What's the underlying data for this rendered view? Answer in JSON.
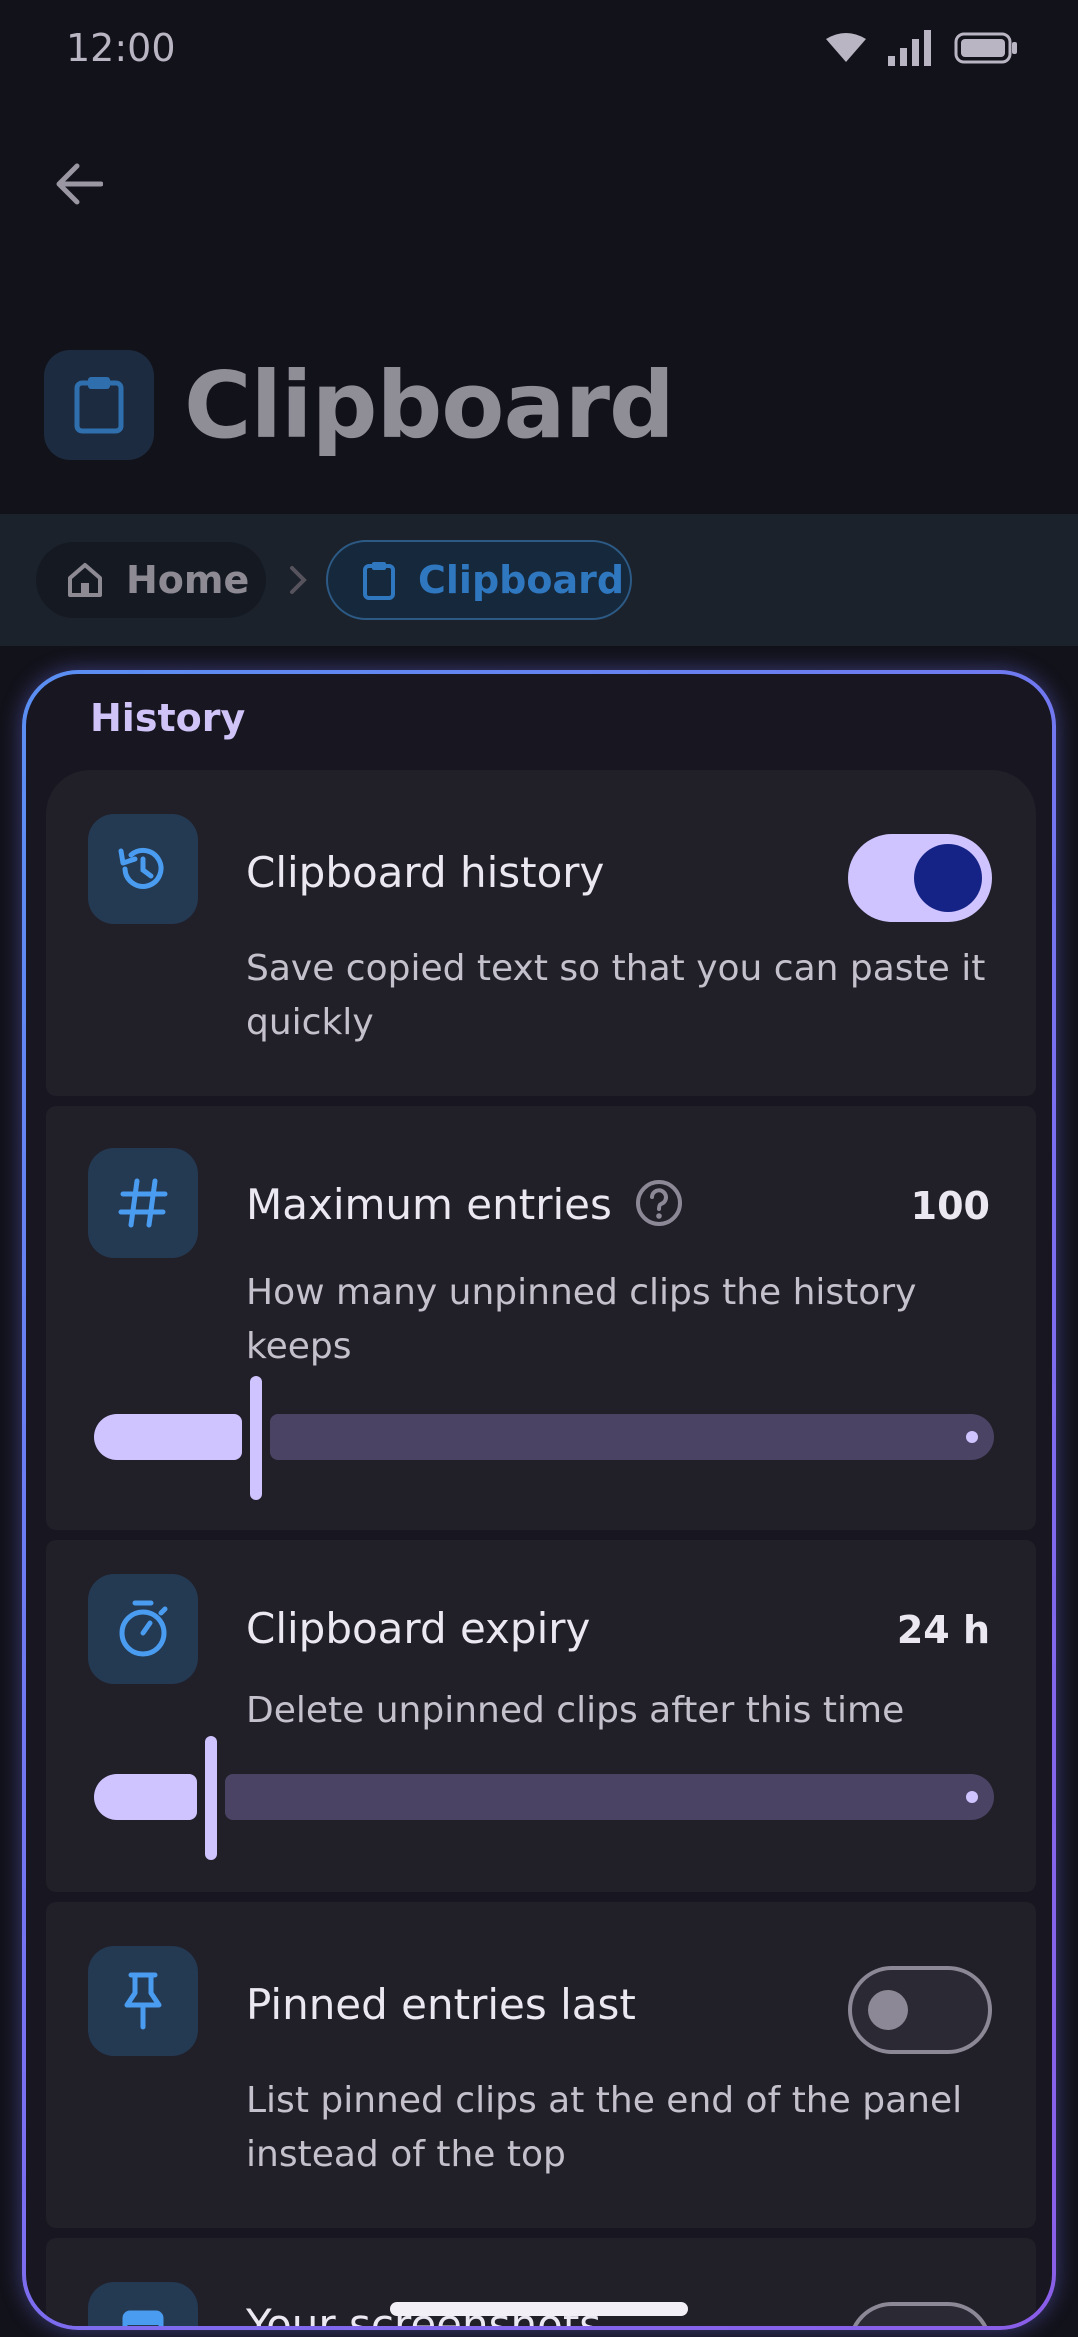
{
  "status_bar": {
    "time": "12:00"
  },
  "header": {
    "title": "Clipboard"
  },
  "breadcrumb": {
    "home": "Home",
    "current": "Clipboard"
  },
  "section": {
    "title": "History"
  },
  "settings": {
    "clipboard_history": {
      "title": "Clipboard history",
      "description": "Save copied text so that you can paste it quickly",
      "enabled": true
    },
    "maximum_entries": {
      "title": "Maximum entries",
      "description": "How many unpinned clips the history keeps",
      "value": "100",
      "slider_fraction": 0.18
    },
    "clipboard_expiry": {
      "title": "Clipboard expiry",
      "description": "Delete unpinned clips after this time",
      "value": "24 h",
      "slider_fraction": 0.13
    },
    "pinned_entries_last": {
      "title": "Pinned entries last",
      "description": "List pinned clips at the end of the panel instead of the top",
      "enabled": false
    },
    "your_screenshots": {
      "title": "Your screenshots"
    }
  },
  "colors": {
    "accent": "#cfc4ff",
    "accent_dark": "#162386",
    "icon_blue": "#4a9cf0",
    "panel_border_start": "#5a8ff2",
    "panel_border_end": "#8a5ee8"
  }
}
